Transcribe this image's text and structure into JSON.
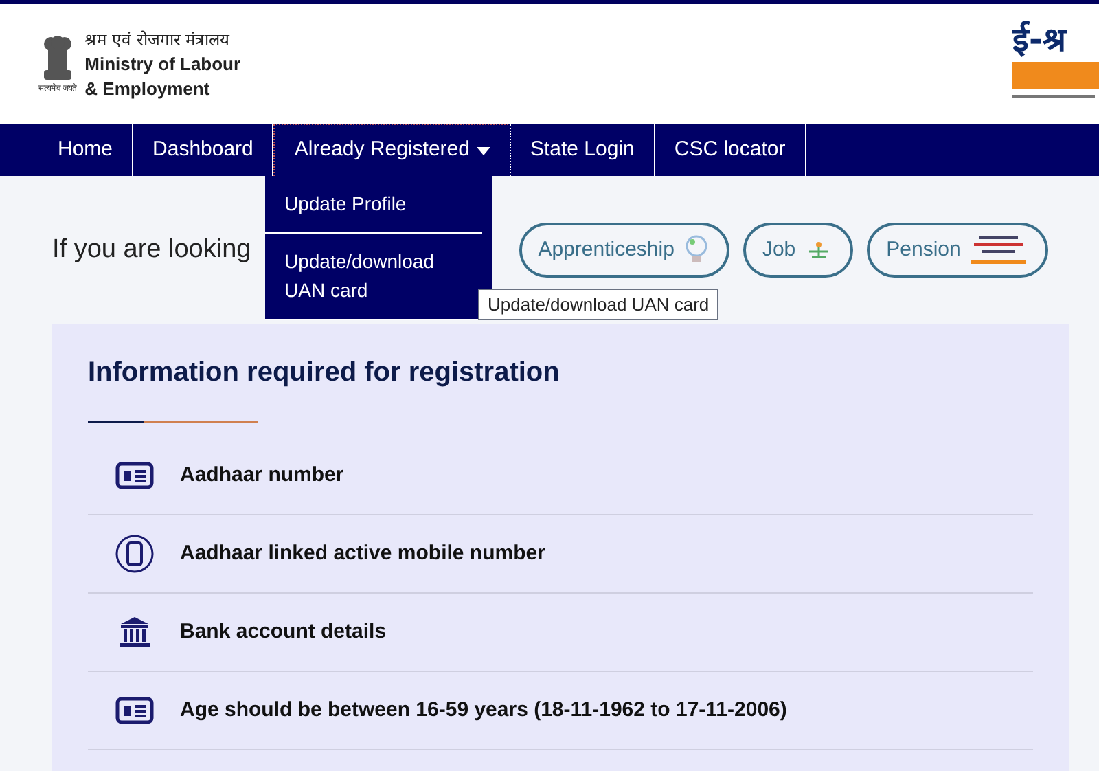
{
  "header": {
    "emblem_motto": "सत्यमेव जयते",
    "ministry_hindi": "श्रम एवं रोजगार मंत्रालय",
    "ministry_lines": [
      "Ministry of Labour",
      "& Employment"
    ],
    "brand": "ई-श्र"
  },
  "nav": [
    {
      "label": "Home",
      "kind": "link",
      "selected": false
    },
    {
      "label": "Dashboard",
      "kind": "link",
      "selected": false
    },
    {
      "label": "Already Registered",
      "kind": "dropdown",
      "selected": true
    },
    {
      "label": "State Login",
      "kind": "link",
      "selected": false
    },
    {
      "label": "CSC locator",
      "kind": "link",
      "selected": false
    }
  ],
  "dropdown_menu": [
    "Update Profile",
    "Update/download UAN card"
  ],
  "tooltip": "Update/download UAN card",
  "looking_for": {
    "text": "If you are looking",
    "options": [
      {
        "label": "Apprenticeship",
        "kind": "bulb"
      },
      {
        "label": "Job",
        "kind": "plant"
      },
      {
        "label": "Pension",
        "kind": "banner"
      }
    ]
  },
  "info_card": {
    "title": "Information required for registration",
    "items": [
      {
        "text": "Aadhaar number",
        "kind": "id-card"
      },
      {
        "text": "Aadhaar linked active mobile number",
        "kind": "mobile"
      },
      {
        "text": "Bank account details",
        "kind": "bank"
      },
      {
        "text": "Age should be between 16-59 years (18-11-1962 to 17-11-2006)",
        "kind": "id-card"
      }
    ]
  }
}
